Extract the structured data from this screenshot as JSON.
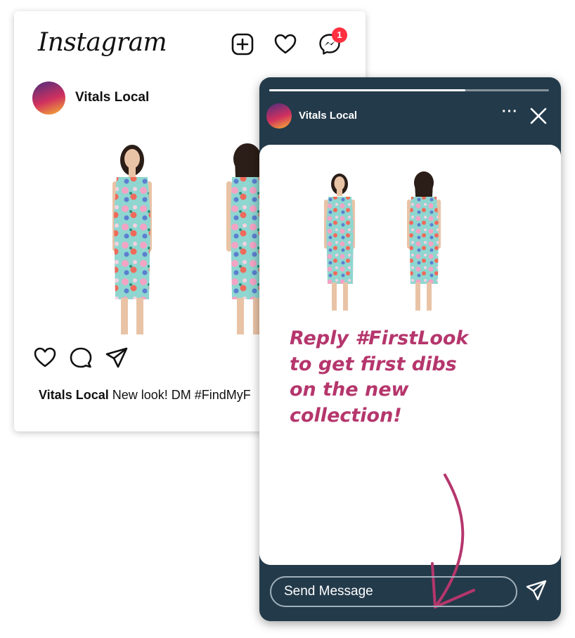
{
  "feed_post": {
    "app_logo": "Instagram",
    "header_icons": [
      "add-post-icon",
      "heart-icon",
      "messenger-icon"
    ],
    "messenger_badge": "1",
    "author": "Vitals Local",
    "image_description_icons": [
      "dress-front-photo",
      "dress-back-photo"
    ],
    "action_icons": [
      "heart-icon",
      "comment-icon",
      "share-icon"
    ],
    "caption_user": "Vitals Local",
    "caption_text": "New look! DM #FindMyF"
  },
  "story": {
    "author": "Vitals Local",
    "progress": 0.7,
    "more_label": "···",
    "text_lines": [
      "Reply #FirstLook",
      "to get first dibs",
      "on the new",
      "collection!"
    ],
    "message_placeholder": "Send Message"
  },
  "colors": {
    "story_bg": "#233a4a",
    "accent_text": "#b5366c",
    "badge": "#ff3040"
  }
}
